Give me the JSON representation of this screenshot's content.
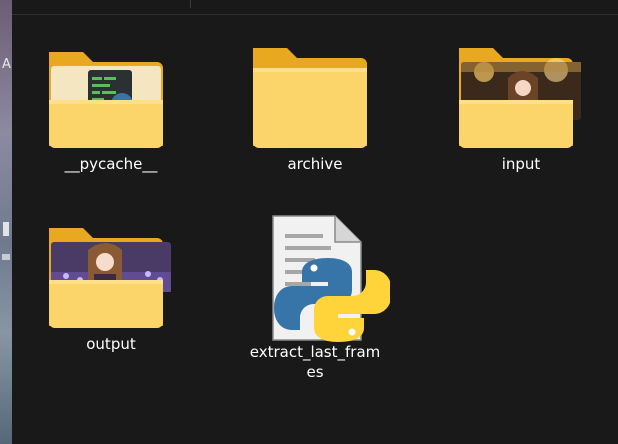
{
  "explorer": {
    "items": [
      {
        "label": "__pycache__",
        "type": "folder",
        "icon": "folder-python-thumbnail-icon"
      },
      {
        "label": "archive",
        "type": "folder",
        "icon": "folder-icon"
      },
      {
        "label": "input",
        "type": "folder",
        "icon": "folder-image-thumbnail-icon"
      },
      {
        "label": "output",
        "type": "folder",
        "icon": "folder-image-thumbnail-icon"
      },
      {
        "label": "extract_last_frames",
        "type": "file",
        "icon": "python-file-icon"
      }
    ]
  },
  "desktop": {
    "edge_glyph": "A"
  },
  "colors": {
    "background": "#191919",
    "folder_back": "#e8a820",
    "folder_front": "#fcd56a",
    "python_blue": "#3775a9",
    "python_yellow": "#ffd43b",
    "text": "#ffffff"
  }
}
